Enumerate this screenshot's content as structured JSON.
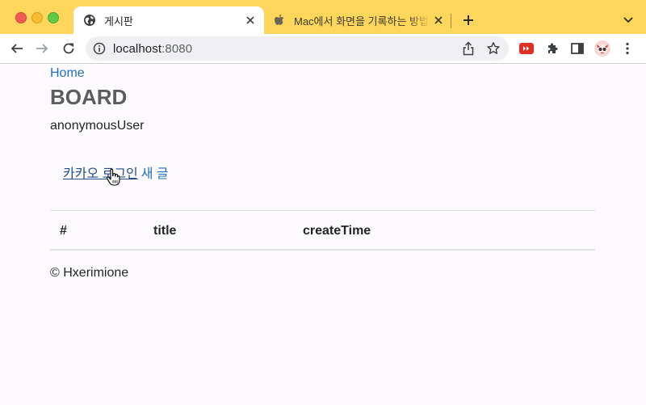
{
  "browser": {
    "tabs": [
      {
        "title": "게시판",
        "active": true,
        "favicon": "globe-icon"
      },
      {
        "title": "Mac에서 화면을 기록하는 방법 - Apple 지원",
        "active": false,
        "favicon": "apple-icon"
      }
    ],
    "url": {
      "host": "localhost",
      "port": ":8080"
    }
  },
  "page": {
    "home_link": "Home",
    "title": "BOARD",
    "user": "anonymousUser",
    "kakao_login": "카카오 로그인",
    "new_post": "새 글",
    "table": {
      "headers": [
        "#",
        "title",
        "createTime"
      ],
      "rows": []
    },
    "footer": "© Hxerimione"
  },
  "colors": {
    "tab_strip": "#fdd65b",
    "link": "#1f6fc6",
    "heading": "#595c60"
  }
}
